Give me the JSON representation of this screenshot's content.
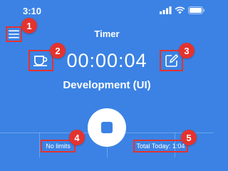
{
  "status_bar": {
    "time": "3:10",
    "icons": [
      "signal-icon",
      "wifi-icon",
      "battery-icon"
    ]
  },
  "header": {
    "menu_icon": "hamburger-menu-icon",
    "title": "Timer"
  },
  "timer": {
    "elapsed": "00:00:04",
    "project": "Development (UI)",
    "break_icon": "coffee-cup-icon",
    "edit_icon": "edit-entry-icon"
  },
  "controls": {
    "stop_icon": "stop-icon"
  },
  "footer": {
    "limit_text": "No limits",
    "total_text": "Total Today: 1:04"
  },
  "annotations": [
    "1",
    "2",
    "3",
    "4",
    "5"
  ],
  "colors": {
    "background": "#3b82e4",
    "annotation": "#e4332f",
    "foreground": "#ffffff"
  }
}
